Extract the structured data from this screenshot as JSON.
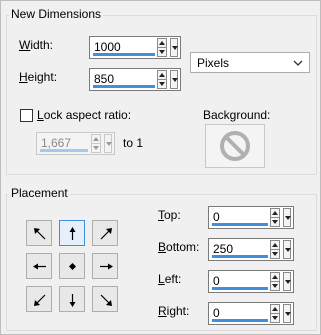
{
  "new_dimensions": {
    "title": "New Dimensions",
    "width_label_mnemonic": "W",
    "width_label_rest": "idth:",
    "width_value": "1000",
    "height_label_mnemonic": "H",
    "height_label_rest": "eight:",
    "height_value": "850",
    "units_value": "Pixels",
    "lock_label_mnemonic": "L",
    "lock_label_rest": "ock aspect ratio:",
    "lock_checked": false,
    "ratio_value": "1,667",
    "ratio_suffix": "to 1",
    "background_label": "Background:",
    "background_icon": "no-symbol-icon"
  },
  "placement": {
    "title": "Placement",
    "top_label_mnemonic": "T",
    "top_label_rest": "op:",
    "top_value": "0",
    "bottom_label_mnemonic": "B",
    "bottom_label_rest": "ottom:",
    "bottom_value": "250",
    "left_label_mnemonic": "L",
    "left_label_rest": "eft:",
    "left_value": "0",
    "right_label_mnemonic": "R",
    "right_label_rest": "ight:",
    "right_value": "0",
    "anchors": [
      "top-left",
      "top",
      "top-right",
      "left",
      "center",
      "right",
      "bottom-left",
      "bottom",
      "bottom-right"
    ],
    "selected_anchor": "top"
  },
  "colors": {
    "accent": "#3f8ee0",
    "dialog_bg": "#f0f0f0"
  }
}
